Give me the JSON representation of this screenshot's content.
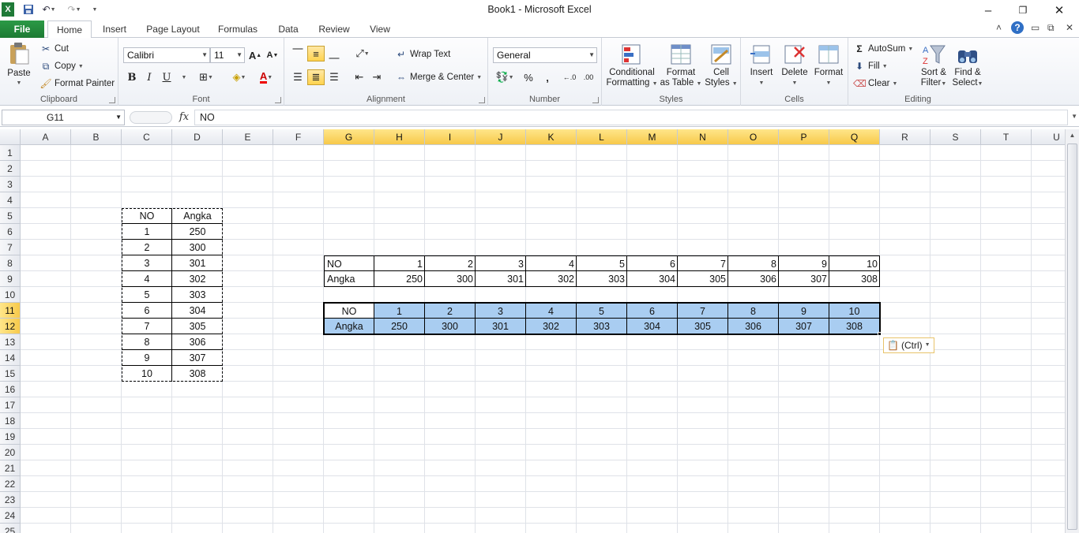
{
  "window": {
    "title": "Book1 - Microsoft Excel",
    "qat": [
      "save",
      "undo",
      "redo",
      "customize"
    ],
    "controls": [
      "minimize",
      "restore",
      "close"
    ]
  },
  "tabs": [
    {
      "label": "File",
      "active": false
    },
    {
      "label": "Home",
      "active": true
    },
    {
      "label": "Insert",
      "active": false
    },
    {
      "label": "Page Layout",
      "active": false
    },
    {
      "label": "Formulas",
      "active": false
    },
    {
      "label": "Data",
      "active": false
    },
    {
      "label": "Review",
      "active": false
    },
    {
      "label": "View",
      "active": false
    }
  ],
  "ribbon": {
    "clipboard": {
      "label": "Clipboard",
      "paste": "Paste",
      "cut": "Cut",
      "copy": "Copy",
      "format_painter": "Format Painter"
    },
    "font": {
      "label": "Font",
      "name": "Calibri",
      "size": "11",
      "bold": "B",
      "italic": "I",
      "underline": "U"
    },
    "alignment": {
      "label": "Alignment",
      "wrap": "Wrap Text",
      "merge": "Merge & Center"
    },
    "number": {
      "label": "Number",
      "format": "General",
      "percent": "%",
      "comma": ","
    },
    "styles": {
      "label": "Styles",
      "conditional": [
        "Conditional",
        "Formatting"
      ],
      "format_table": [
        "Format",
        "as Table"
      ],
      "cell_styles": [
        "Cell",
        "Styles"
      ]
    },
    "cells": {
      "label": "Cells",
      "insert": "Insert",
      "delete": "Delete",
      "format": "Format"
    },
    "editing": {
      "label": "Editing",
      "autosum": "AutoSum",
      "fill": "Fill",
      "clear": "Clear",
      "sort": [
        "Sort &",
        "Filter"
      ],
      "find": [
        "Find &",
        "Select"
      ]
    }
  },
  "formula_bar": {
    "name_box": "G11",
    "fx": "fx",
    "content": "NO"
  },
  "sheet": {
    "columns": [
      "A",
      "B",
      "C",
      "D",
      "E",
      "F",
      "G",
      "H",
      "I",
      "J",
      "K",
      "L",
      "M",
      "N",
      "O",
      "P",
      "Q",
      "R",
      "S",
      "T",
      "U"
    ],
    "selected_columns": [
      "G",
      "H",
      "I",
      "J",
      "K",
      "L",
      "M",
      "N",
      "O",
      "P",
      "Q"
    ],
    "rows": [
      "1",
      "2",
      "3",
      "4",
      "5",
      "6",
      "7",
      "8",
      "9",
      "10",
      "11",
      "12",
      "13",
      "14",
      "15",
      "16",
      "17",
      "18",
      "19",
      "20",
      "21",
      "22",
      "23",
      "24",
      "25"
    ],
    "selected_rows": [
      "11",
      "12"
    ],
    "vertical_table": {
      "headers": [
        "NO",
        "Angka"
      ],
      "rows": [
        [
          "1",
          "250"
        ],
        [
          "2",
          "300"
        ],
        [
          "3",
          "301"
        ],
        [
          "4",
          "302"
        ],
        [
          "5",
          "303"
        ],
        [
          "6",
          "304"
        ],
        [
          "7",
          "305"
        ],
        [
          "8",
          "306"
        ],
        [
          "9",
          "307"
        ],
        [
          "10",
          "308"
        ]
      ]
    },
    "horizontal_table": {
      "no_label": "NO",
      "angka_label": "Angka",
      "no_values": [
        "1",
        "2",
        "3",
        "4",
        "5",
        "6",
        "7",
        "8",
        "9",
        "10"
      ],
      "angka_values": [
        "250",
        "300",
        "301",
        "302",
        "303",
        "304",
        "305",
        "306",
        "307",
        "308"
      ]
    },
    "pasted_table": {
      "no_label": "NO",
      "angka_label": "Angka",
      "no_values": [
        "1",
        "2",
        "3",
        "4",
        "5",
        "6",
        "7",
        "8",
        "9",
        "10"
      ],
      "angka_values": [
        "250",
        "300",
        "301",
        "302",
        "303",
        "304",
        "305",
        "306",
        "307",
        "308"
      ]
    },
    "paste_options_label": "(Ctrl)",
    "selection_color": "#a9cdf1",
    "header_highlight": "#f7c94a"
  }
}
